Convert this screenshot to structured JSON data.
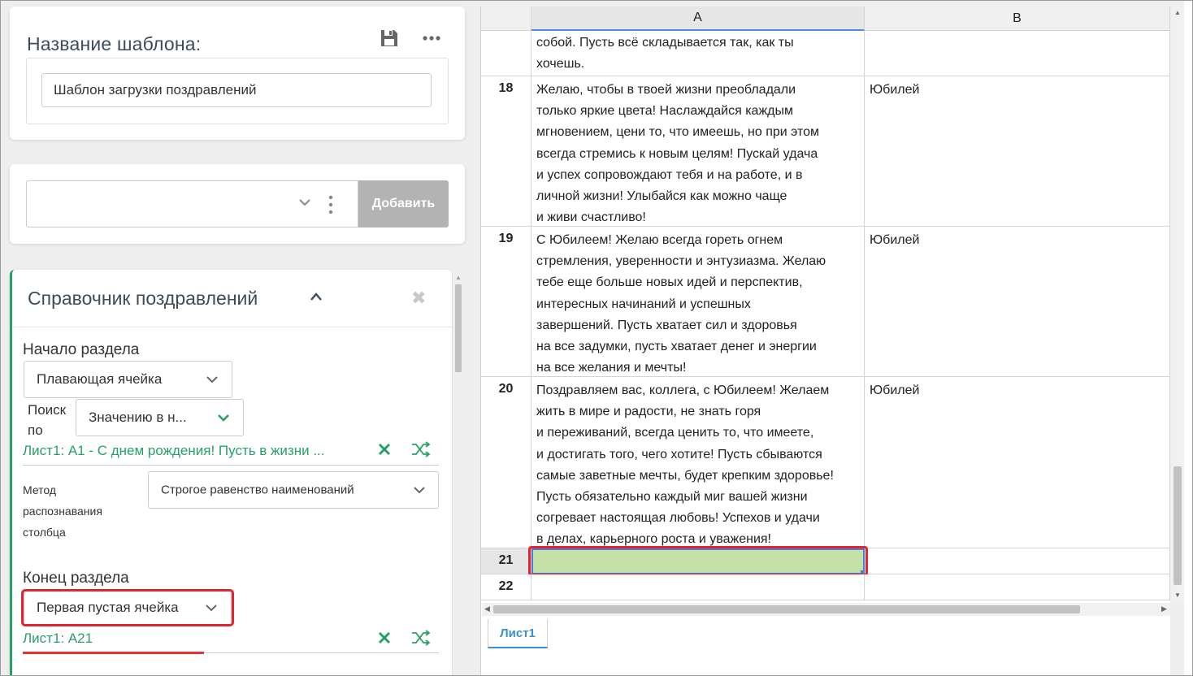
{
  "template": {
    "title": "Название шаблона:",
    "name_value": "Шаблон загрузки поздравлений"
  },
  "add_section": {
    "button_label": "Добавить"
  },
  "section": {
    "title": "Справочник поздравлений",
    "start_label": "Начало раздела",
    "start_type": "Плавающая ячейка",
    "search_label": "Поиск по",
    "search_by": "Значению в н...",
    "start_ref": "Лист1: A1 - С днем рождения! Пусть в жизни ...",
    "method_label": "Метод распознавания столбца",
    "method_value": "Строгое равенство наименований",
    "end_label": "Конец раздела",
    "end_type": "Первая пустая ячейка",
    "end_ref": "Лист1: A21"
  },
  "sheet": {
    "columns": [
      "A",
      "B"
    ],
    "rows": [
      {
        "num": "",
        "a": "собой. Пусть всё складывается так, как ты\nхочешь.",
        "b": ""
      },
      {
        "num": "18",
        "a": "Желаю, чтобы в твоей жизни преобладали\nтолько яркие цвета! Наслаждайся каждым\nмгновением, цени то, что имеешь, но при этом\nвсегда стремись к новым целям! Пускай удача\nи успех сопровождают тебя и на работе, и в\nличной жизни! Улыбайся как можно чаще\nи живи счастливо!",
        "b": "Юбилей"
      },
      {
        "num": "19",
        "a": "С Юбилеем! Желаю всегда гореть огнем\nстремления, уверенности и энтузиазма. Желаю\nтебе еще больше новых идей и перспектив,\nинтересных начинаний и успешных\nзавершений. Пусть хватает сил и здоровья\nна все задумки, пусть хватает денег и энергии\nна все желания и мечты!",
        "b": "Юбилей"
      },
      {
        "num": "20",
        "a": "Поздравляем вас, коллега, с Юбилеем! Желаем\nжить в мире и радости, не знать горя\nи переживаний, всегда ценить то, что имеете,\nи достигать того, чего хотите! Пусть сбываются\nсамые заветные мечты, будет крепким здоровье!\nПусть обязательно каждый миг вашей жизни\nсогревает настоящая любовь! Успехов и удачи\nв делах, карьерного роста и уважения!",
        "b": "Юбилей"
      },
      {
        "num": "21",
        "a": "",
        "b": ""
      },
      {
        "num": "22",
        "a": "",
        "b": ""
      }
    ],
    "tab": "Лист1"
  },
  "colors": {
    "accent_green": "#27a067",
    "highlight_red": "#e02432",
    "selected_cell": "#c5e1a5",
    "tab_blue": "#3a8fcc"
  }
}
